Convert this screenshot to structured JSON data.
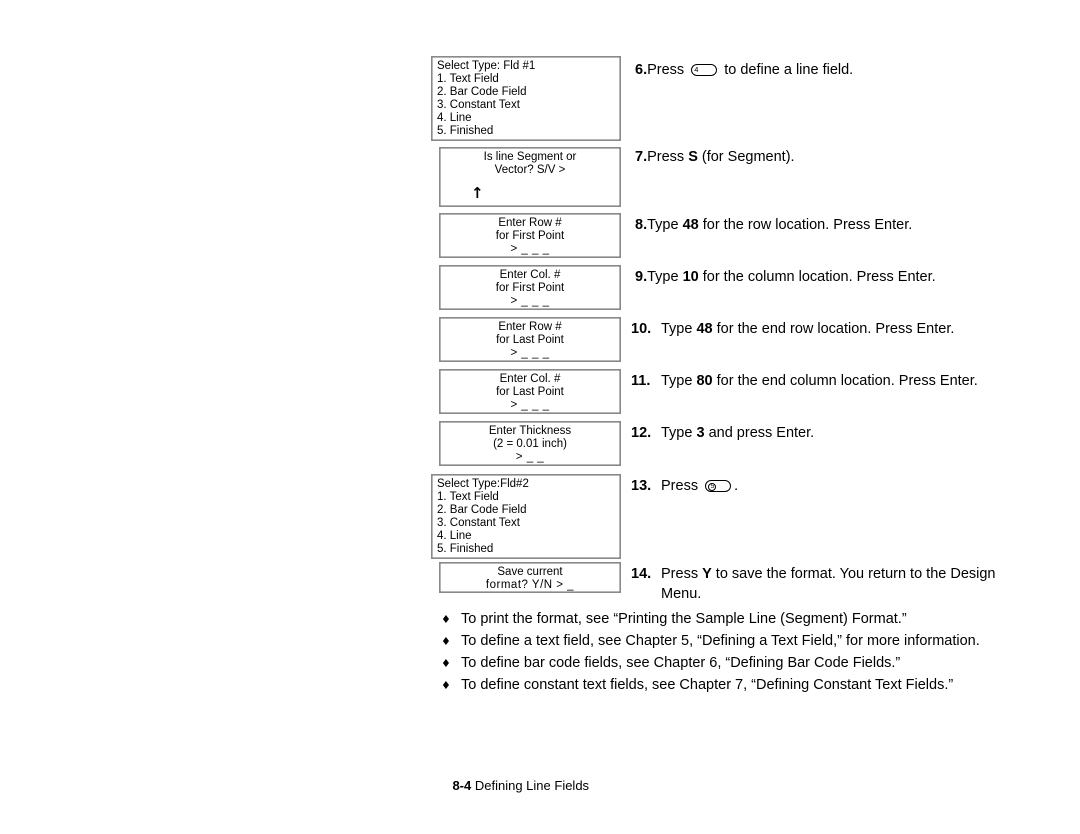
{
  "page": {
    "footer_page_number": "8-4",
    "footer_title": "Defining Line Fields"
  },
  "lcd_screens": [
    {
      "name": "select-type-field-1",
      "align": "left",
      "lines": [
        "Select Type: Fld #1",
        "1. Text Field",
        "2. Bar Code Field",
        "3. Constant Text",
        "4. Line",
        "5. Finished"
      ]
    },
    {
      "name": "segment-or-vector-prompt",
      "align": "center",
      "lines": [
        "Is line Segment or",
        "Vector? S/V >"
      ],
      "up_arrow": "↑"
    },
    {
      "name": "enter-row-first-point",
      "align": "center",
      "lines": [
        "Enter Row #",
        "for First Point",
        "> _ _ _"
      ]
    },
    {
      "name": "enter-col-first-point",
      "align": "center",
      "lines": [
        "Enter Col. #",
        "for First Point",
        "> _ _ _"
      ]
    },
    {
      "name": "enter-row-last-point",
      "align": "center",
      "lines": [
        "Enter Row #",
        "for Last Point",
        "> _ _ _"
      ]
    },
    {
      "name": "enter-col-last-point",
      "align": "center",
      "lines": [
        "Enter Col. #",
        "for Last Point",
        "> _ _ _"
      ]
    },
    {
      "name": "enter-thickness",
      "align": "center",
      "lines": [
        "Enter Thickness",
        "(2 = 0.01 inch)",
        "> _ _"
      ]
    },
    {
      "name": "select-type-field-2",
      "align": "left",
      "lines": [
        "Select Type:Fld#2",
        "1. Text Field",
        "2. Bar Code Field",
        "3. Constant Text",
        "4. Line",
        "5. Finished"
      ]
    },
    {
      "name": "save-current-format",
      "align": "center",
      "lines": [
        "Save current",
        "format? Y/N > _"
      ]
    }
  ],
  "steps": [
    {
      "number": "6.",
      "segments": [
        {
          "t": "Press "
        },
        {
          "key": "4"
        },
        {
          "t": " to define a line field."
        }
      ]
    },
    {
      "number": "7.",
      "segments": [
        {
          "t": "Press "
        },
        {
          "t": "S",
          "bold": true
        },
        {
          "t": " (for Segment)."
        }
      ]
    },
    {
      "number": "8.",
      "segments": [
        {
          "t": "Type "
        },
        {
          "t": "48",
          "bold": true
        },
        {
          "t": " for the row location.  Press Enter."
        }
      ]
    },
    {
      "number": "9.",
      "segments": [
        {
          "t": "Type "
        },
        {
          "t": "10",
          "bold": true
        },
        {
          "t": " for the column location.  Press Enter."
        }
      ]
    },
    {
      "number": "10.",
      "segments": [
        {
          "t": "Type "
        },
        {
          "t": "48",
          "bold": true
        },
        {
          "t": " for the end row location.  Press Enter."
        }
      ]
    },
    {
      "number": "11.",
      "segments": [
        {
          "t": "Type "
        },
        {
          "t": "80",
          "bold": true
        },
        {
          "t": " for the end column location.  Press Enter."
        }
      ]
    },
    {
      "number": "12.",
      "segments": [
        {
          "t": "Type "
        },
        {
          "t": "3",
          "bold": true
        },
        {
          "t": " and press Enter."
        }
      ]
    },
    {
      "number": "13.",
      "segments": [
        {
          "t": "Press "
        },
        {
          "key_circled": "5"
        },
        {
          "t": "."
        }
      ]
    },
    {
      "number": "14.",
      "segments": [
        {
          "t": "Press "
        },
        {
          "t": "Y",
          "bold": true
        },
        {
          "t": " to save the format.  You return to the Design Menu."
        }
      ]
    }
  ],
  "bullets": [
    {
      "marker": "♦",
      "text": "To print the format, see “Printing the Sample Line (Segment) Format.”"
    },
    {
      "marker": "♦",
      "text": "To define a text field, see Chapter 5, “Defining a Text Field,” for more information."
    },
    {
      "marker": "♦",
      "text": "To define bar code fields, see Chapter 6, “Defining Bar Code Fields.”"
    },
    {
      "marker": "♦",
      "text": "To define constant text fields, see Chapter 7, “Defining Constant Text Fields.”"
    }
  ]
}
